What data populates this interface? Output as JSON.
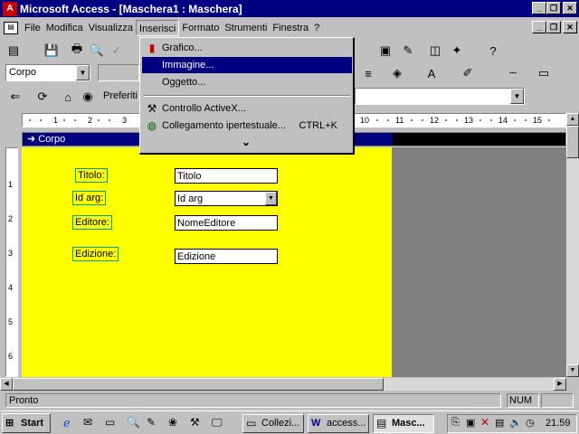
{
  "window": {
    "title": "Microsoft Access - [Maschera1 : Maschera]"
  },
  "menubar": {
    "items": [
      "File",
      "Modifica",
      "Visualizza",
      "Inserisci",
      "Formato",
      "Strumenti",
      "Finestra",
      "?"
    ]
  },
  "format_toolbar": {
    "object_combo": "Corpo"
  },
  "web_toolbar": {
    "favorites_label": "Preferiti"
  },
  "insert_menu": {
    "items": [
      {
        "label": "Grafico...",
        "shortcut": ""
      },
      {
        "label": "Immagine...",
        "shortcut": ""
      },
      {
        "label": "Oggetto...",
        "shortcut": ""
      },
      {
        "label": "Controllo ActiveX...",
        "shortcut": ""
      },
      {
        "label": "Collegamento ipertestuale...",
        "shortcut": "CTRL+K"
      }
    ],
    "expand_glyph": "⌄"
  },
  "ruler": {
    "h_ticks": [
      "1",
      "2",
      "3",
      "10",
      "11",
      "12",
      "13",
      "14",
      "15"
    ],
    "v_ticks": [
      "1",
      "2",
      "3",
      "4",
      "5",
      "6"
    ]
  },
  "section": {
    "header": "Corpo"
  },
  "form": {
    "controls": [
      {
        "label": "Titolo:",
        "field": "Titolo",
        "type": "text"
      },
      {
        "label": "Id arg:",
        "field": "Id arg",
        "type": "combo"
      },
      {
        "label": "Editore:",
        "field": "NomeEditore",
        "type": "text"
      },
      {
        "label": "Edizione:",
        "field": "Edizione",
        "type": "text"
      }
    ]
  },
  "status": {
    "text": "Pronto",
    "num": "NUM"
  },
  "taskbar": {
    "start": "Start",
    "tasks": [
      "Collezi...",
      "access...",
      "Masc..."
    ],
    "clock": "21.59"
  }
}
